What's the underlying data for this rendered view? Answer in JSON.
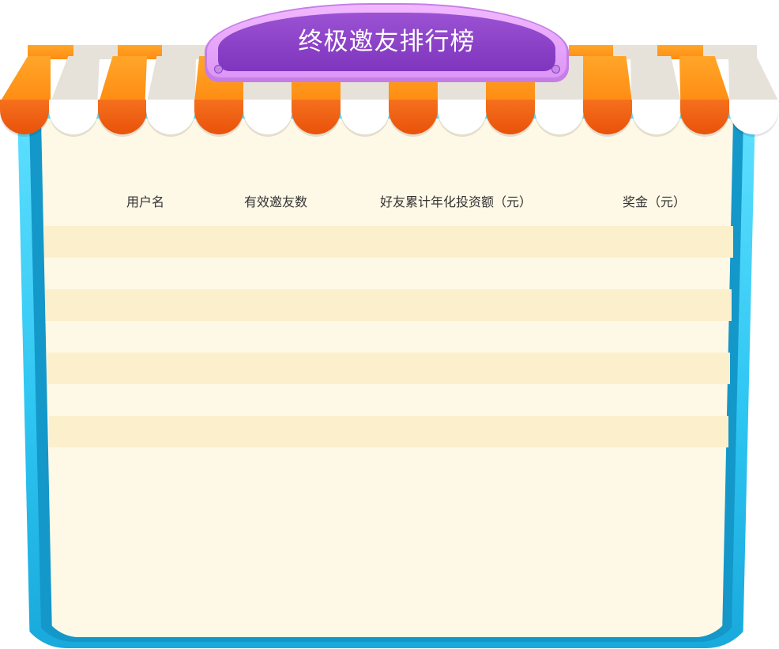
{
  "title": "终极邀友排行榜",
  "table": {
    "headers": [
      "用户名",
      "有效邀友数",
      "好友累计年化投资额（元）",
      "奖金（元）"
    ],
    "rows": []
  },
  "colors": {
    "frame": "#2ec6f2",
    "panel": "#fef8e6",
    "row_alt": "#fcefcc",
    "awning_orange": "#ff8c12",
    "awning_cream": "#e7e2d9",
    "sign_purple": "#8a3fc6"
  }
}
